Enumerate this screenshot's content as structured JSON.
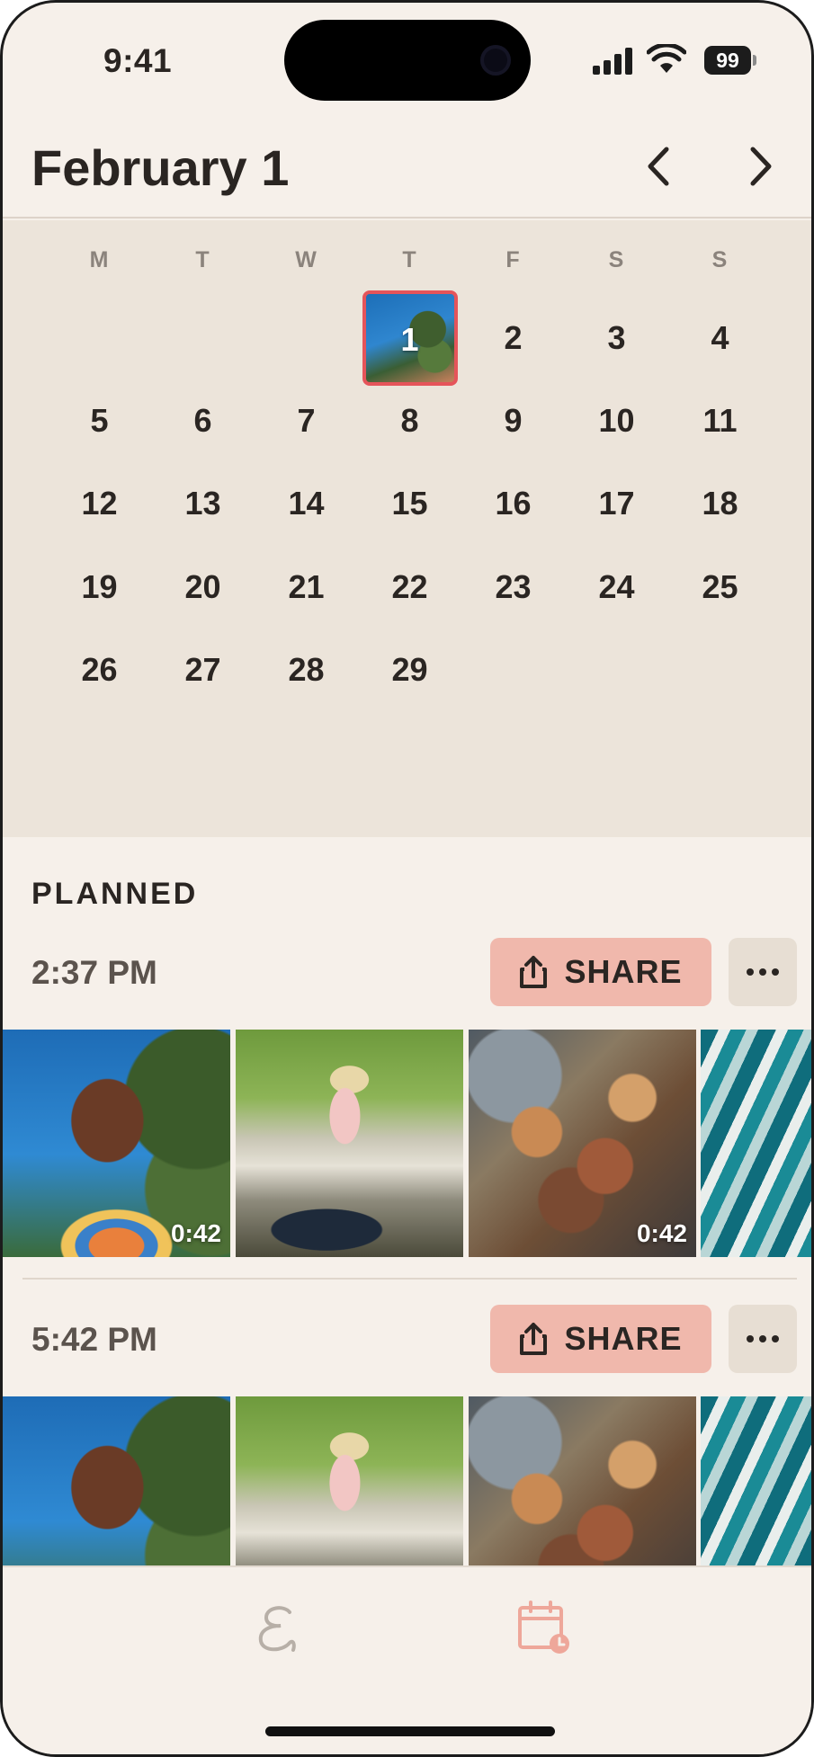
{
  "status_bar": {
    "time": "9:41",
    "battery": "99"
  },
  "header": {
    "title": "February 1",
    "prev_icon": "chevron-left-icon",
    "next_icon": "chevron-right-icon"
  },
  "calendar": {
    "weekdays": [
      "M",
      "T",
      "W",
      "T",
      "F",
      "S",
      "S"
    ],
    "selected_day": "1",
    "days": [
      [
        "",
        "",
        "",
        "1",
        "2",
        "3",
        "4"
      ],
      [
        "5",
        "6",
        "7",
        "8",
        "9",
        "10",
        "11"
      ],
      [
        "12",
        "13",
        "14",
        "15",
        "16",
        "17",
        "18"
      ],
      [
        "19",
        "20",
        "21",
        "22",
        "23",
        "24",
        "25"
      ],
      [
        "26",
        "27",
        "28",
        "29",
        "",
        "",
        ""
      ]
    ]
  },
  "planned": {
    "label": "PLANNED",
    "slots": [
      {
        "time": "2:37 PM",
        "share_label": "SHARE",
        "durations": [
          "0:42",
          "",
          "0:42",
          ""
        ]
      },
      {
        "time": "5:42 PM",
        "share_label": "SHARE",
        "durations": [
          "",
          "",
          "",
          ""
        ]
      }
    ]
  },
  "tabbar": {
    "items": [
      "script-e-icon",
      "calendar-clock-icon"
    ]
  },
  "colors": {
    "accent": "#f0b8ac",
    "selected_border": "#e5545a",
    "background": "#f6f0ea",
    "calendar_bg": "#ece4da"
  }
}
